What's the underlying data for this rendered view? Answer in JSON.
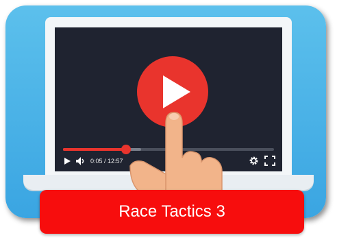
{
  "player": {
    "time_display": "0:05 / 12:57",
    "progress_fraction": 0.3,
    "buffer_fraction": 0.37
  },
  "title": {
    "text": "Race Tactics 3"
  },
  "icons": {
    "play": "play-icon",
    "volume": "volume-icon",
    "settings": "gear-icon",
    "fullscreen": "fullscreen-icon",
    "big_play": "play-button-icon",
    "hand": "pointing-hand-icon"
  },
  "colors": {
    "frame": "#3aa5e2",
    "screen": "#1f2330",
    "accent_red": "#e9342d",
    "title_bg": "#f70d0d"
  }
}
